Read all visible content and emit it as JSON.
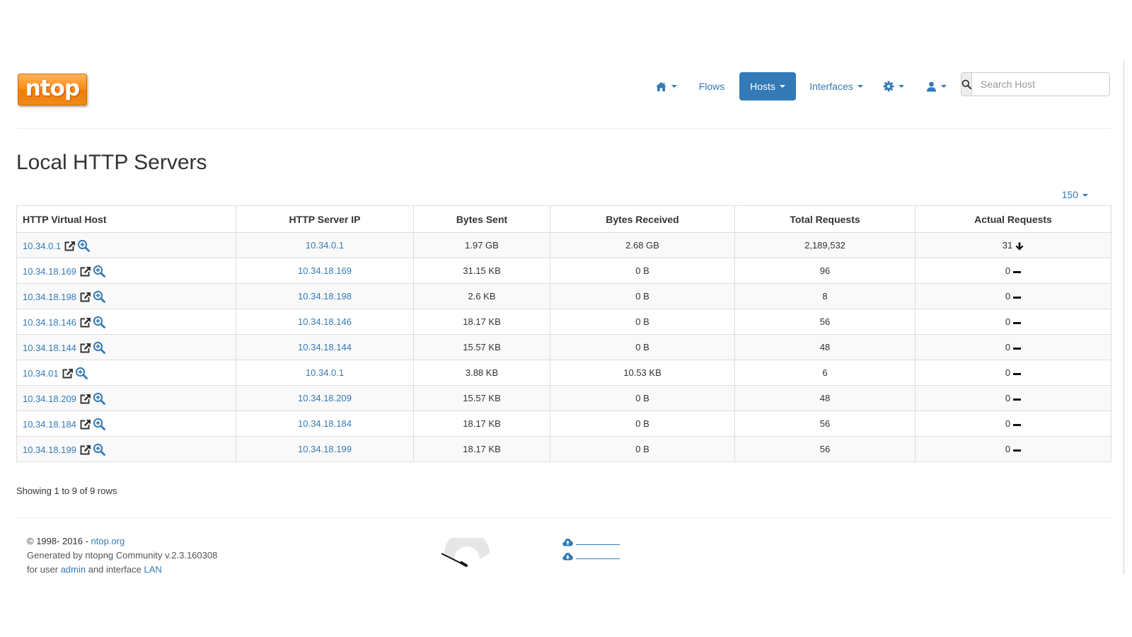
{
  "brand": {
    "logo_text": "ntop"
  },
  "nav": {
    "home_icon": "home-icon",
    "flows": "Flows",
    "hosts": "Hosts",
    "interfaces": "Interfaces",
    "settings_icon": "gear-icon",
    "user_icon": "user-icon",
    "active_color": "#337ab7"
  },
  "search": {
    "placeholder": "Search Host",
    "value": ""
  },
  "page": {
    "title": "Local HTTP Servers",
    "page_size": "150"
  },
  "table": {
    "columns": [
      "HTTP Virtual Host",
      "HTTP Server IP",
      "Bytes Sent",
      "Bytes Received",
      "Total Requests",
      "Actual Requests"
    ],
    "rows": [
      {
        "vhost": "10.34.0.1",
        "ip": "10.34.0.1",
        "sent": "1.97 GB",
        "received": "2.68 GB",
        "total": "2,189,532",
        "actual": "31",
        "trend": "down"
      },
      {
        "vhost": "10.34.18.169",
        "ip": "10.34.18.169",
        "sent": "31.15 KB",
        "received": "0 B",
        "total": "96",
        "actual": "0",
        "trend": "flat"
      },
      {
        "vhost": "10.34.18.198",
        "ip": "10.34.18.198",
        "sent": "2.6 KB",
        "received": "0 B",
        "total": "8",
        "actual": "0",
        "trend": "flat"
      },
      {
        "vhost": "10.34.18.146",
        "ip": "10.34.18.146",
        "sent": "18.17 KB",
        "received": "0 B",
        "total": "56",
        "actual": "0",
        "trend": "flat"
      },
      {
        "vhost": "10.34.18.144",
        "ip": "10.34.18.144",
        "sent": "15.57 KB",
        "received": "0 B",
        "total": "48",
        "actual": "0",
        "trend": "flat"
      },
      {
        "vhost": "10.34.01",
        "ip": "10.34.0.1",
        "sent": "3.88 KB",
        "received": "10.53 KB",
        "total": "6",
        "actual": "0",
        "trend": "flat"
      },
      {
        "vhost": "10.34.18.209",
        "ip": "10.34.18.209",
        "sent": "15.57 KB",
        "received": "0 B",
        "total": "48",
        "actual": "0",
        "trend": "flat"
      },
      {
        "vhost": "10.34.18.184",
        "ip": "10.34.18.184",
        "sent": "18.17 KB",
        "received": "0 B",
        "total": "56",
        "actual": "0",
        "trend": "flat"
      },
      {
        "vhost": "10.34.18.199",
        "ip": "10.34.18.199",
        "sent": "18.17 KB",
        "received": "0 B",
        "total": "56",
        "actual": "0",
        "trend": "flat"
      }
    ]
  },
  "pagination": {
    "summary": "Showing 1 to 9 of 9 rows"
  },
  "footer": {
    "copyright": "© 1998- 2016 - ",
    "site_link": "ntop.org",
    "generated": "Generated by ntopng Community v.2.3.160308",
    "for_user": "for user ",
    "user_link": "admin",
    "and_interface": " and interface ",
    "interface_link": "LAN"
  }
}
